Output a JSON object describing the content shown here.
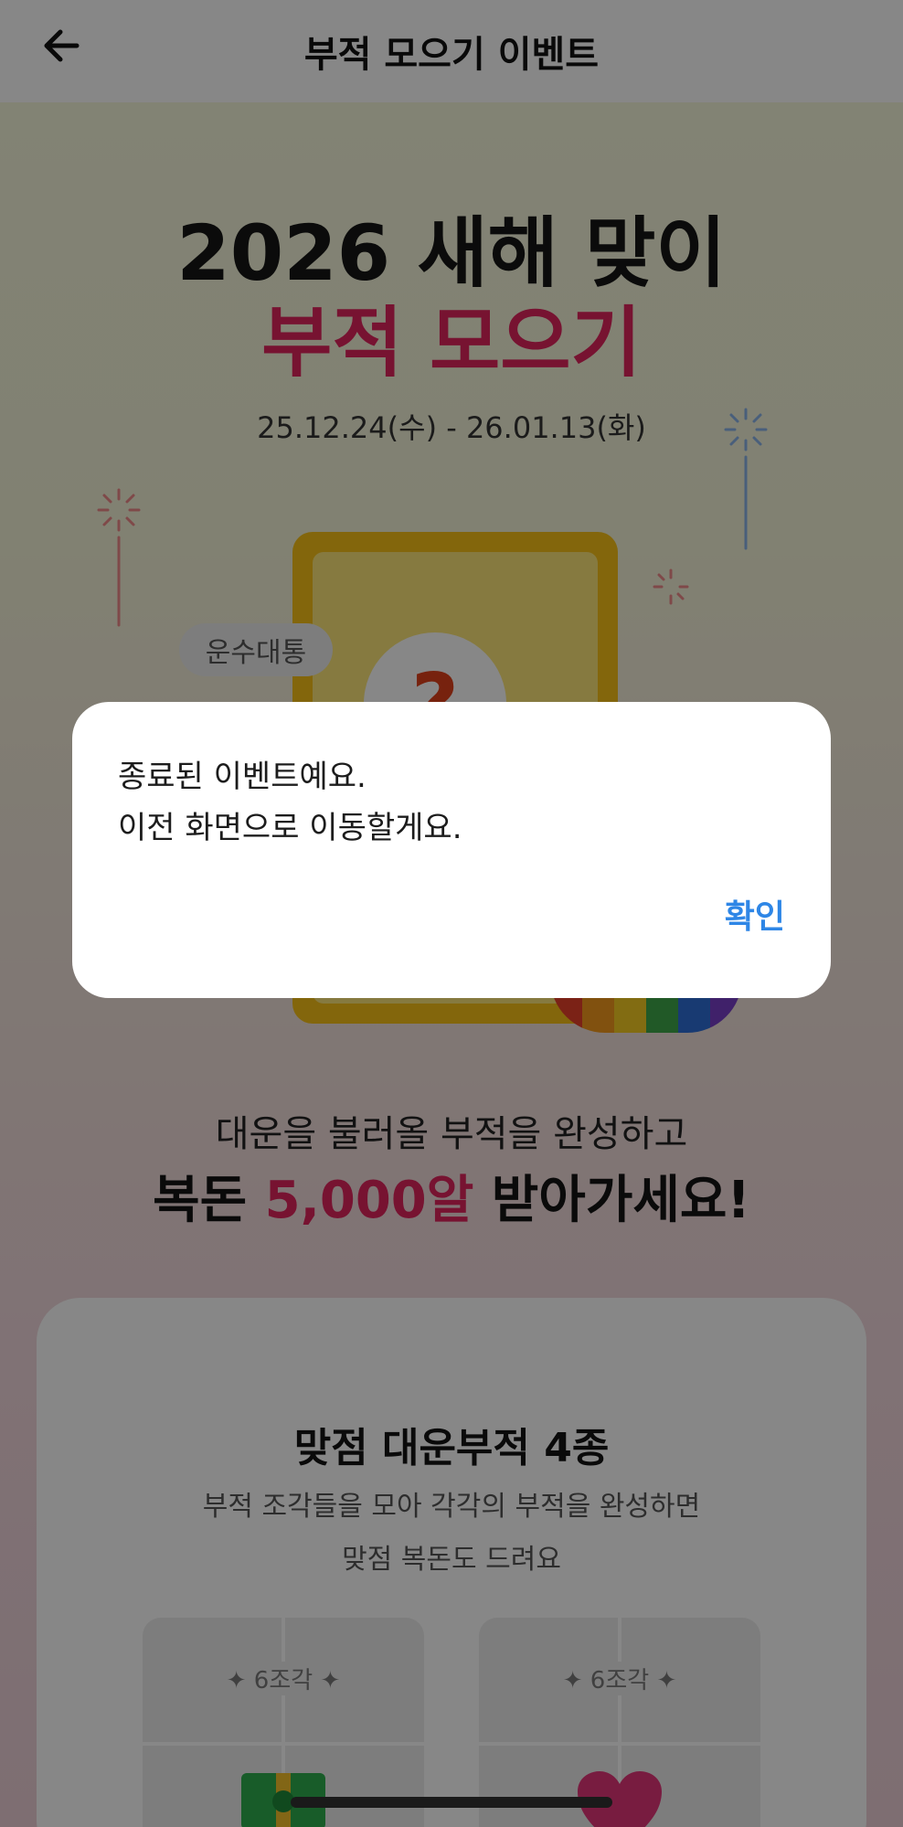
{
  "header": {
    "title": "부적 모으기 이벤트",
    "back_icon": "arrow-left-icon"
  },
  "hero": {
    "line1": "2026 새해 맞이",
    "line2": "부적 모으기",
    "period": "25.12.24(수) - 26.01.13(화)",
    "badge": "운수대통",
    "card_symbol": "?"
  },
  "prize": {
    "line1": "대운을 불러올 부적을 완성하고",
    "prefix": "복돈 ",
    "amount": "5,000알",
    "suffix": " 받아가세요!"
  },
  "section": {
    "title": "맞점 대운부적 4종",
    "desc_line1": "부적 조각들을 모아 각각의 부적을 완성하면",
    "desc_line2": "맞점 복돈도 드려요",
    "cards": [
      {
        "label": "✦ 6조각 ✦",
        "icon": "money-icon"
      },
      {
        "label": "✦ 6조각 ✦",
        "icon": "heart-icon"
      }
    ]
  },
  "dialog": {
    "message_line1": "종료된 이벤트예요.",
    "message_line2": "이전 화면으로 이동할게요.",
    "confirm_label": "확인"
  },
  "colors": {
    "accent_pink": "#e0245e",
    "confirm_blue": "#2e86e6",
    "talisman_yellow": "#f7c117"
  }
}
